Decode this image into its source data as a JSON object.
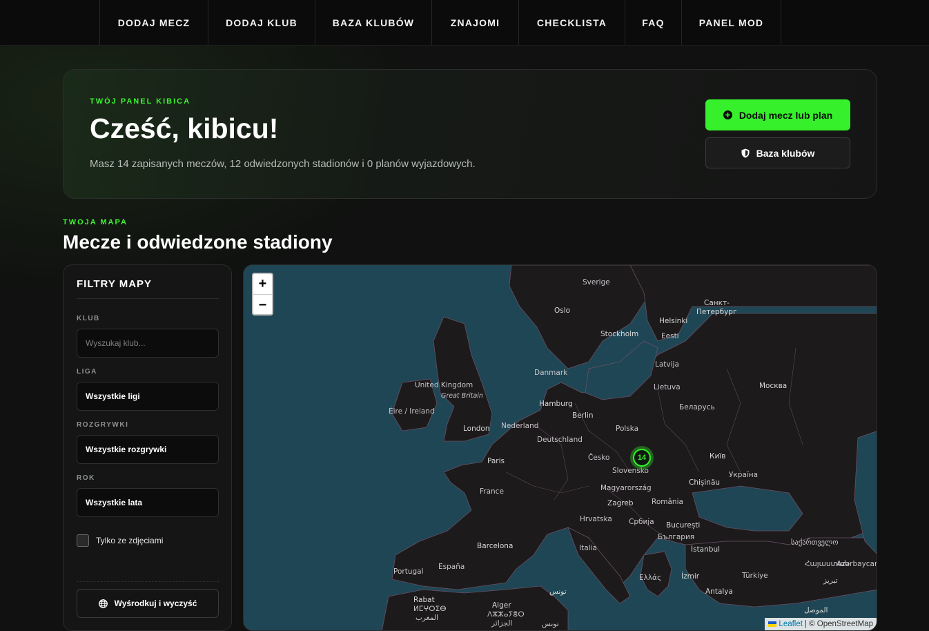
{
  "nav": {
    "items": [
      "DODAJ MECZ",
      "DODAJ KLUB",
      "BAZA KLUBÓW",
      "ZNAJOMI",
      "CHECKLISTA",
      "FAQ",
      "PANEL MOD"
    ]
  },
  "hero": {
    "eyebrow": "TWÓJ PANEL KIBICA",
    "title": "Cześć, kibicu!",
    "subtitle": "Masz 14 zapisanych meczów, 12 odwiedzonych stadionów i 0 planów wyjazdowych.",
    "primary_button": "Dodaj mecz lub plan",
    "secondary_button": "Baza klubów"
  },
  "section": {
    "eyebrow": "TWOJA MAPA",
    "title": "Mecze i odwiedzone stadiony"
  },
  "filters": {
    "title": "FILTRY MAPY",
    "club_label": "KLUB",
    "club_placeholder": "Wyszukaj klub...",
    "league_label": "LIGA",
    "league_value": "Wszystkie ligi",
    "competition_label": "ROZGRYWKI",
    "competition_value": "Wszystkie rozgrywki",
    "year_label": "ROK",
    "year_value": "Wszystkie lata",
    "photos_only_label": "Tylko ze zdjęciami",
    "photos_only_checked": false,
    "center_button": "Wyśrodkuj i wyczyść"
  },
  "map": {
    "zoom_in": "+",
    "zoom_out": "−",
    "cluster_count": "14",
    "attribution_leaflet": "Leaflet",
    "attribution_rest": "| © OpenStreetMap",
    "labels": {
      "sverige": "Sverige",
      "oslo": "Oslo",
      "sankt": "Санкт-",
      "peterburg": "Петербург",
      "helsinki": "Helsinki",
      "stockholm": "Stockholm",
      "eesti": "Eesti",
      "latvija": "Latvija",
      "danmark": "Danmark",
      "uk": "United Kingdom",
      "gb": "Great Britain",
      "lietuva": "Lietuva",
      "moskva": "Москва",
      "hamburg": "Hamburg",
      "eire": "Éire / Ireland",
      "berlin": "Berlin",
      "belarus": "Беларусь",
      "london": "London",
      "nederland": "Nederland",
      "polska": "Polska",
      "deutschland": "Deutschland",
      "paris": "Paris",
      "cesko": "Česko",
      "kyiv": "Київ",
      "slovensko": "Slovensko",
      "ukraina": "Україна",
      "chisinau": "Chișinău",
      "france": "France",
      "magyarorszag": "Magyarország",
      "romania": "România",
      "zagreb": "Zagreb",
      "hrvatska": "Hrvatska",
      "srbija": "Србија",
      "bucuresti": "București",
      "balgaria": "България",
      "barcelona": "Barcelona",
      "italia": "Italia",
      "istanbul": "İstanbul",
      "georgia": "საქართველო",
      "portugal": "Portugal",
      "espana": "España",
      "armenia": "Հայաստան",
      "azerbaycan": "Azərbaycan",
      "ellas": "Ελλάς",
      "izmir": "İzmir",
      "turkiye": "Türkiye",
      "tabriz": "تبریز",
      "tunis": "تونس",
      "antalya": "Antalya",
      "rabat": "Rabat",
      "morocco_tf": "ⵍⵎⵖⵔⵉⴱ",
      "morocco_ar": "المغرب",
      "alger": "Alger",
      "algeria_tf": "ⴷⵣⵣⴰⵢⴻⵔ",
      "algeria_ar": "الجزائر",
      "tunisia": "تونس",
      "mosul": "الموصل"
    }
  }
}
